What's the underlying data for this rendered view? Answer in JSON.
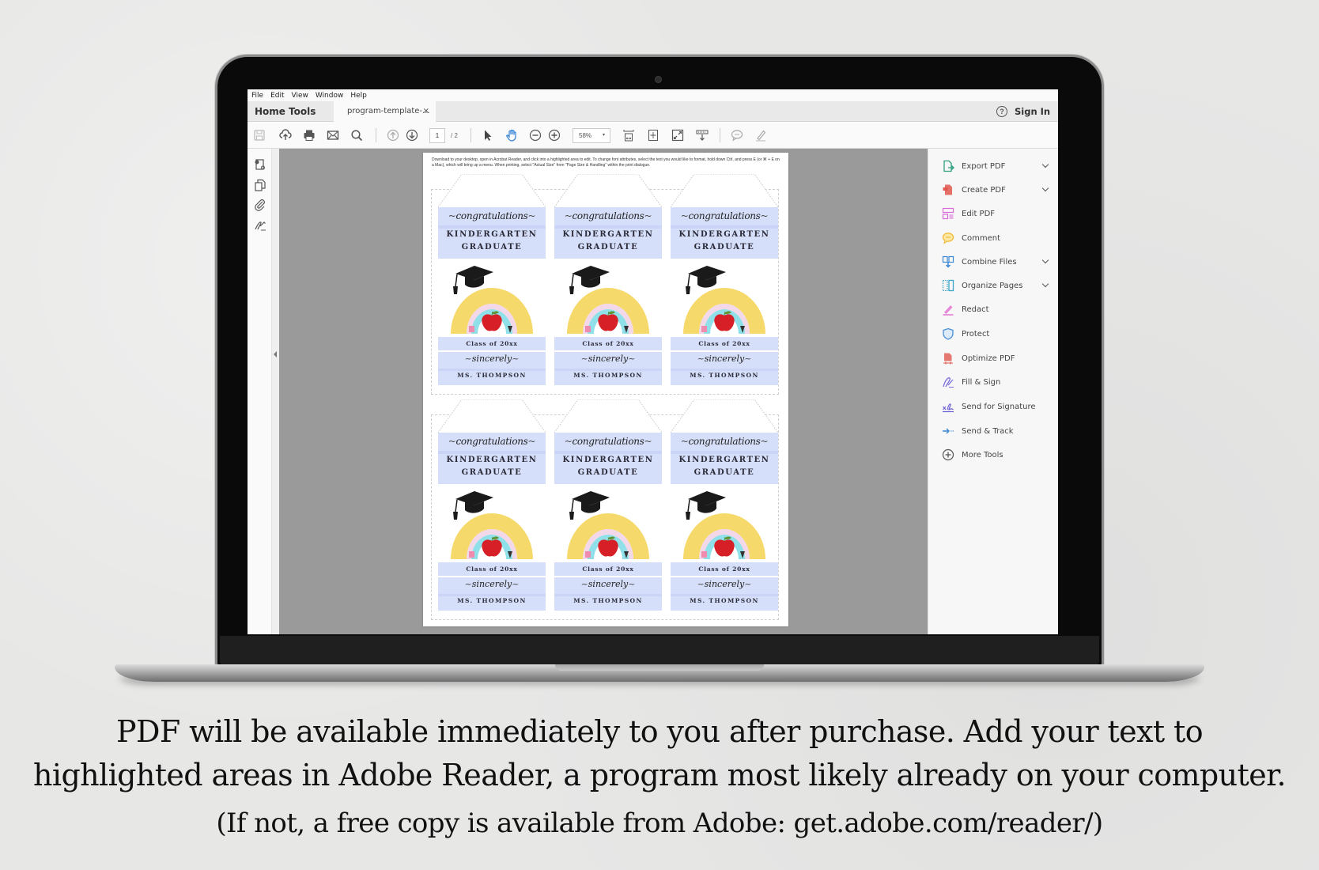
{
  "app": {
    "menu": [
      "File",
      "Edit",
      "View",
      "Window",
      "Help"
    ],
    "nav_tabs": [
      "Home",
      "Tools"
    ],
    "document_tab": "program-template-...",
    "close_glyph": "×",
    "help_glyph": "?",
    "sign_in": "Sign In"
  },
  "toolbar": {
    "icons": [
      "save-icon",
      "upload-cloud-icon",
      "print-icon",
      "email-icon",
      "search-icon",
      "previous-page-icon",
      "next-page-icon",
      "select-arrow-icon",
      "hand-tool-icon",
      "zoom-out-icon",
      "zoom-in-icon",
      "fit-width-icon",
      "fit-page-icon",
      "full-screen-icon",
      "scroll-mode-icon",
      "comment-icon",
      "highlight-pen-icon"
    ],
    "current_page": "1",
    "total_pages": "/ 2",
    "zoom_level": "58%",
    "zoom_caret": "▾"
  },
  "left_pane": {
    "icons": [
      "page-thumbnails-icon",
      "copy-pages-icon",
      "attachments-icon",
      "signatures-icon"
    ]
  },
  "tools_panel": {
    "items": [
      {
        "label": "Export PDF",
        "icon": "export-pdf-icon",
        "color": "#2e9e7e",
        "expandable": true
      },
      {
        "label": "Create PDF",
        "icon": "create-pdf-icon",
        "color": "#e0584f",
        "expandable": true
      },
      {
        "label": "Edit PDF",
        "icon": "edit-pdf-icon",
        "color": "#d96ad9",
        "expandable": false
      },
      {
        "label": "Comment",
        "icon": "comment-icon",
        "color": "#f0b429",
        "expandable": false
      },
      {
        "label": "Combine Files",
        "icon": "combine-files-icon",
        "color": "#3b86d6",
        "expandable": true
      },
      {
        "label": "Organize Pages",
        "icon": "organize-pages-icon",
        "color": "#3aa6c9",
        "expandable": true
      },
      {
        "label": "Redact",
        "icon": "redact-icon",
        "color": "#e36bd0",
        "expandable": false
      },
      {
        "label": "Protect",
        "icon": "protect-icon",
        "color": "#4a8fd6",
        "expandable": false
      },
      {
        "label": "Optimize PDF",
        "icon": "optimize-pdf-icon",
        "color": "#e0584f",
        "expandable": false
      },
      {
        "label": "Fill & Sign",
        "icon": "fill-sign-icon",
        "color": "#7a6fe0",
        "expandable": false
      },
      {
        "label": "Send for Signature",
        "icon": "send-signature-icon",
        "color": "#6a5fd6",
        "expandable": false
      },
      {
        "label": "Send & Track",
        "icon": "send-track-icon",
        "color": "#3b86d6",
        "expandable": false
      },
      {
        "label": "More Tools",
        "icon": "more-tools-icon",
        "color": "#555555",
        "expandable": false
      }
    ]
  },
  "document": {
    "instructions": "Download to your desktop, open in Acrobat Reader, and click into a highlighted area to edit. To change font attributes, select the text you would like to format, hold down Ctrl, and press E (or ⌘ + E on a Mac), which will bring up a menu.  When printing, select \"Actual Size\" from \"Page Size & Handling\" within the print dialogue.",
    "tag": {
      "script_title": "congratulations",
      "line1": "KINDERGARTEN",
      "line2": "GRADUATE",
      "class_line": "Class of 20xx",
      "closing": "sincerely",
      "teacher": "MS. THOMPSON"
    },
    "tag_count": 6,
    "colors": {
      "highlight": "#d6dff9",
      "rainbow_outer": "#f6d96b",
      "rainbow_inner": "#8fe0e8",
      "apple": "#d61f26",
      "cap": "#1a1a1a"
    }
  },
  "caption": {
    "line1": "PDF will be available immediately to you after purchase.  Add your text to",
    "line2": "highlighted areas in Adobe Reader, a program most likely already on your computer.",
    "line3": "(If not, a free copy is available from Adobe: get.adobe.com/reader/)"
  }
}
